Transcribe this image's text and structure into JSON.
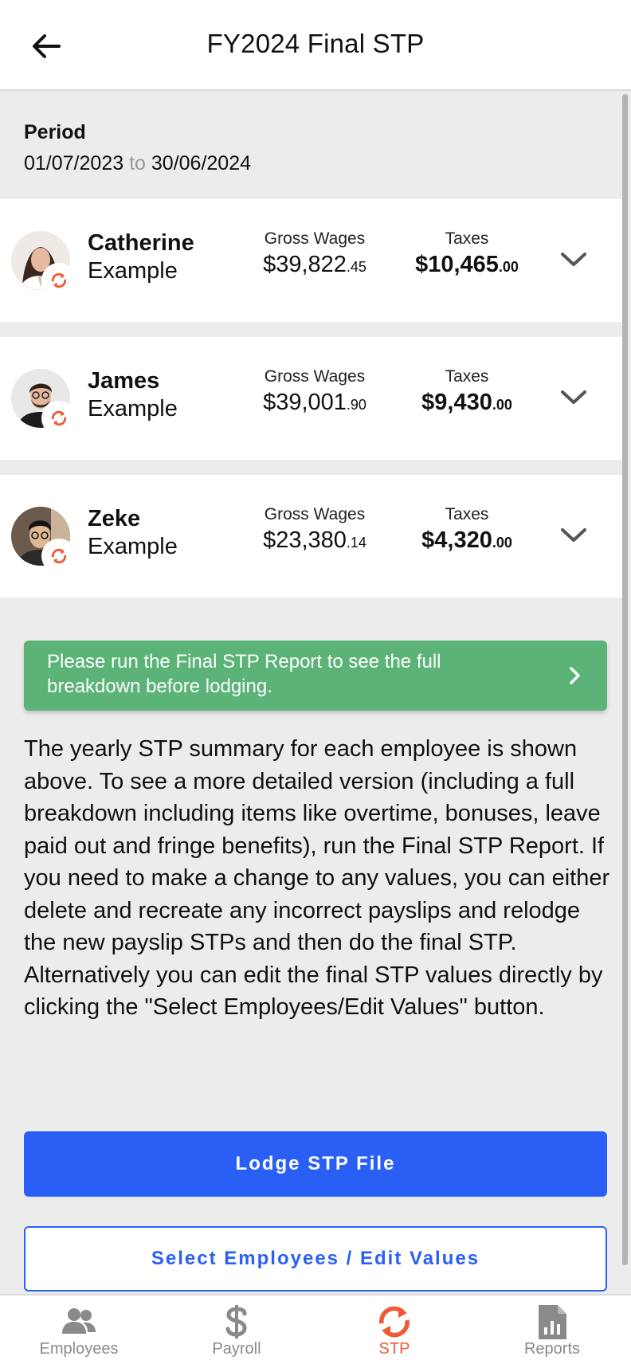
{
  "header": {
    "title": "FY2024 Final STP"
  },
  "period": {
    "label": "Period",
    "start": "01/07/2023",
    "to": "to",
    "end": "30/06/2024"
  },
  "employees": [
    {
      "first": "Catherine",
      "last": "Example",
      "gross_label": "Gross Wages",
      "gross_dollars": "$39,822",
      "gross_cents": ".45",
      "taxes_label": "Taxes",
      "taxes_dollars": "$10,465",
      "taxes_cents": ".00"
    },
    {
      "first": "James",
      "last": "Example",
      "gross_label": "Gross Wages",
      "gross_dollars": "$39,001",
      "gross_cents": ".90",
      "taxes_label": "Taxes",
      "taxes_dollars": "$9,430",
      "taxes_cents": ".00"
    },
    {
      "first": "Zeke",
      "last": "Example",
      "gross_label": "Gross Wages",
      "gross_dollars": "$23,380",
      "gross_cents": ".14",
      "taxes_label": "Taxes",
      "taxes_dollars": "$4,320",
      "taxes_cents": ".00"
    }
  ],
  "notice": {
    "text": "Please run the Final STP Report to see the full breakdown before lodging."
  },
  "description": "The yearly STP summary for each employee is shown above. To see a more detailed version (including a full breakdown including items like overtime, bonuses, leave paid out and fringe benefits), run the Final STP Report. If you need to make a change to any values, you can either delete and recreate any incorrect payslips and relodge the new payslip STPs and then do the final STP. Alternatively you can edit the final STP values directly by clicking the \"Select Employees/Edit Values\" button.",
  "buttons": {
    "lodge": "Lodge STP File",
    "select": "Select Employees / Edit Values"
  },
  "tabs": [
    {
      "label": "Employees",
      "icon": "people-icon"
    },
    {
      "label": "Payroll",
      "icon": "dollar-icon"
    },
    {
      "label": "STP",
      "icon": "sync-icon",
      "active": true
    },
    {
      "label": "Reports",
      "icon": "report-icon"
    }
  ],
  "colors": {
    "primary": "#2a5ff5",
    "success": "#5bb377",
    "accent": "#ef5a36",
    "inactive": "#8a8a8a"
  }
}
